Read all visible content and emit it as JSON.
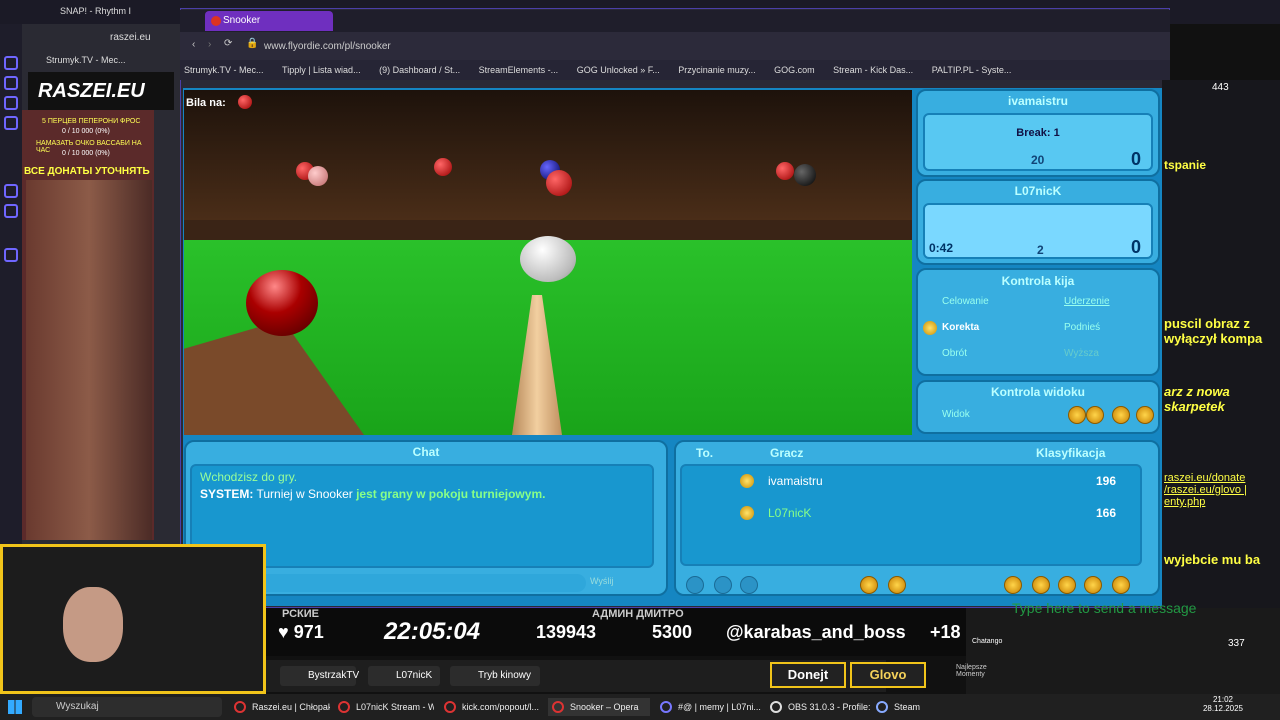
{
  "top_tabs": {
    "snap": "SNAP! - Rhythm I",
    "left_addr": "raszei.eu",
    "left_tab": "Strumyk.TV - Mec..."
  },
  "left_overlay": {
    "brand": "RASZEI.EU",
    "line1": "5 ПЕРЦЕВ ПЕПЕРОНИ ФРОС",
    "val1": "0 / 10 000 (0%)",
    "line2": "НАМАЗАТЬ ОЧКО ВАССАБИ НА ЧАС",
    "val2": "0 / 10 000 (0%)",
    "banner": "ВСЕ ДОНАТЫ УТОЧНЯТЬ"
  },
  "browser": {
    "tab_title": "Snooker",
    "url": "www.flyordie.com/pl/snooker",
    "bookmarks": [
      "Strumyk.TV - Mec...",
      "Tipply | Lista wiad...",
      "(9) Dashboard / St...",
      "StreamElements -...",
      "GOG Unlocked » F...",
      "Przycinanie muzy...",
      "GOG.com",
      "Stream - Kick Das...",
      "PALTIP.PL - Syste..."
    ]
  },
  "game": {
    "bila_na": "Bila na:",
    "player1": {
      "name": "ivamaistru",
      "break_label": "Break: 1",
      "break_pts": "20",
      "score": "0"
    },
    "player2": {
      "name": "L07nicK",
      "timer": "0:42",
      "break_pts": "2",
      "score": "0"
    },
    "cue_control": {
      "title": "Kontrola kija",
      "options": [
        "Celowanie",
        "Uderzenie",
        "Korekta",
        "Podnieś",
        "Obrót",
        "Wyższa"
      ],
      "selected": "Korekta"
    },
    "view_control": {
      "title": "Kontrola widoku",
      "option": "Widok"
    },
    "chat": {
      "title": "Chat",
      "line1": "Wchodzisz do gry.",
      "system_label": "SYSTEM:",
      "system_white": "Turniej w Snooker",
      "system_green": "jest grany w pokoju turniejowym.",
      "send": "Wyślij"
    },
    "players": {
      "col_to": "To.",
      "col_player": "Gracz",
      "col_rank": "Klasyfikacja",
      "rows": [
        {
          "name": "ivamaistru",
          "rank": "196"
        },
        {
          "name": "L07nicK",
          "rank": "166"
        }
      ]
    }
  },
  "ticker": {
    "rate": "♥ 971",
    "time": "22:05:04",
    "views": "139943",
    "yt": "5300",
    "handle": "@karabas_and_boss",
    "plus": "+18",
    "top_left": "РСКИЕ",
    "top_mid": "АДМИН ДМИТРО"
  },
  "twitch": {
    "viewers": "443",
    "msg1": "tspanie",
    "msg2": "puscil obraz z wyłączył kompa",
    "msg3": "arz z nowa skarpetek",
    "msg4": "raszei.eu/donate /raszei.eu/glovo | enty.php",
    "msg5": "wyjebcie mu ba",
    "input": "Type here to send a message",
    "chatango": "Chatango",
    "count": "337"
  },
  "stream_tabs": {
    "a": "BystrzakTV",
    "b": "L07nicK",
    "c": "Tryb kinowy",
    "donate": "Donejt",
    "glovo": "Glovo",
    "best": "Najlepsze Momenty"
  },
  "taskbar": {
    "search": "Wyszukaj",
    "items": [
      "Raszei.eu | Chłopak...",
      "L07nicK Stream - W...",
      "kick.com/popout/l...",
      "Snooker – Opera",
      "#@ | memy | L07ni...",
      "OBS 31.0.3 - Profile:...",
      "Steam"
    ],
    "time": "21:02",
    "date": "28.12.2025"
  }
}
